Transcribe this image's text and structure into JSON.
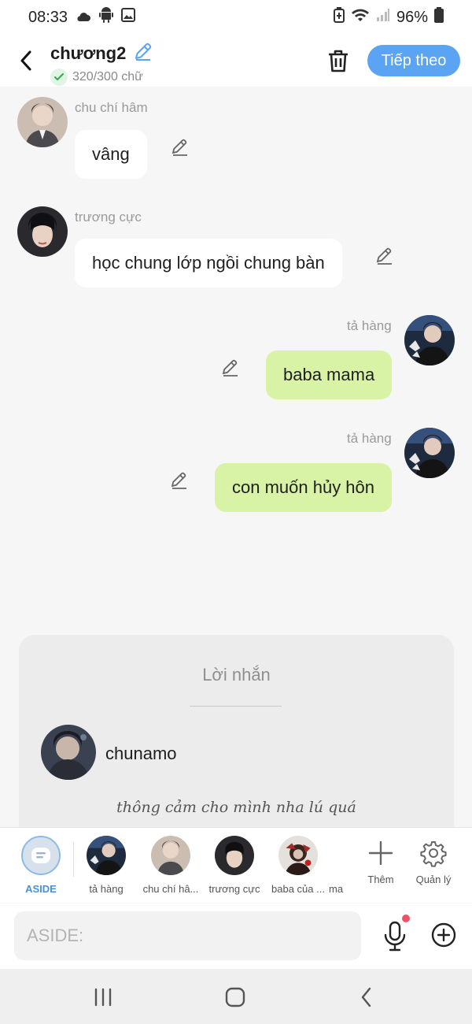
{
  "status_bar": {
    "time": "08:33",
    "battery": "96%"
  },
  "header": {
    "title": "chương2",
    "word_count": "320/300 chữ",
    "next_label": "Tiếp theo"
  },
  "messages": [
    {
      "sender": "chu chí hâm",
      "text": "vâng",
      "side": "left"
    },
    {
      "sender": "trương cực",
      "text": "học chung lớp ngồi chung bàn",
      "side": "left"
    },
    {
      "sender": "tả hàng",
      "text": "baba mama",
      "side": "right"
    },
    {
      "sender": "tả hàng",
      "text": "con muốn hủy hôn",
      "side": "right"
    }
  ],
  "note": {
    "heading": "Lời nhắn",
    "author": "chunamo",
    "text": "thông cảm cho mình nha lú quá"
  },
  "characters": {
    "aside_label": "ASIDE",
    "items": [
      {
        "label": "tả hàng"
      },
      {
        "label": "chu chí hâ..."
      },
      {
        "label": "trương cực"
      },
      {
        "label": "baba của ..."
      },
      {
        "label": "ma"
      }
    ],
    "add_label": "Thêm",
    "manage_label": "Quản lý"
  },
  "composer": {
    "placeholder": "ASIDE:"
  },
  "colors": {
    "accent_blue": "#5aa4f3",
    "my_bubble": "#d8f3a6",
    "other_bubble": "#ffffff",
    "mic_dot": "#f0506a"
  }
}
